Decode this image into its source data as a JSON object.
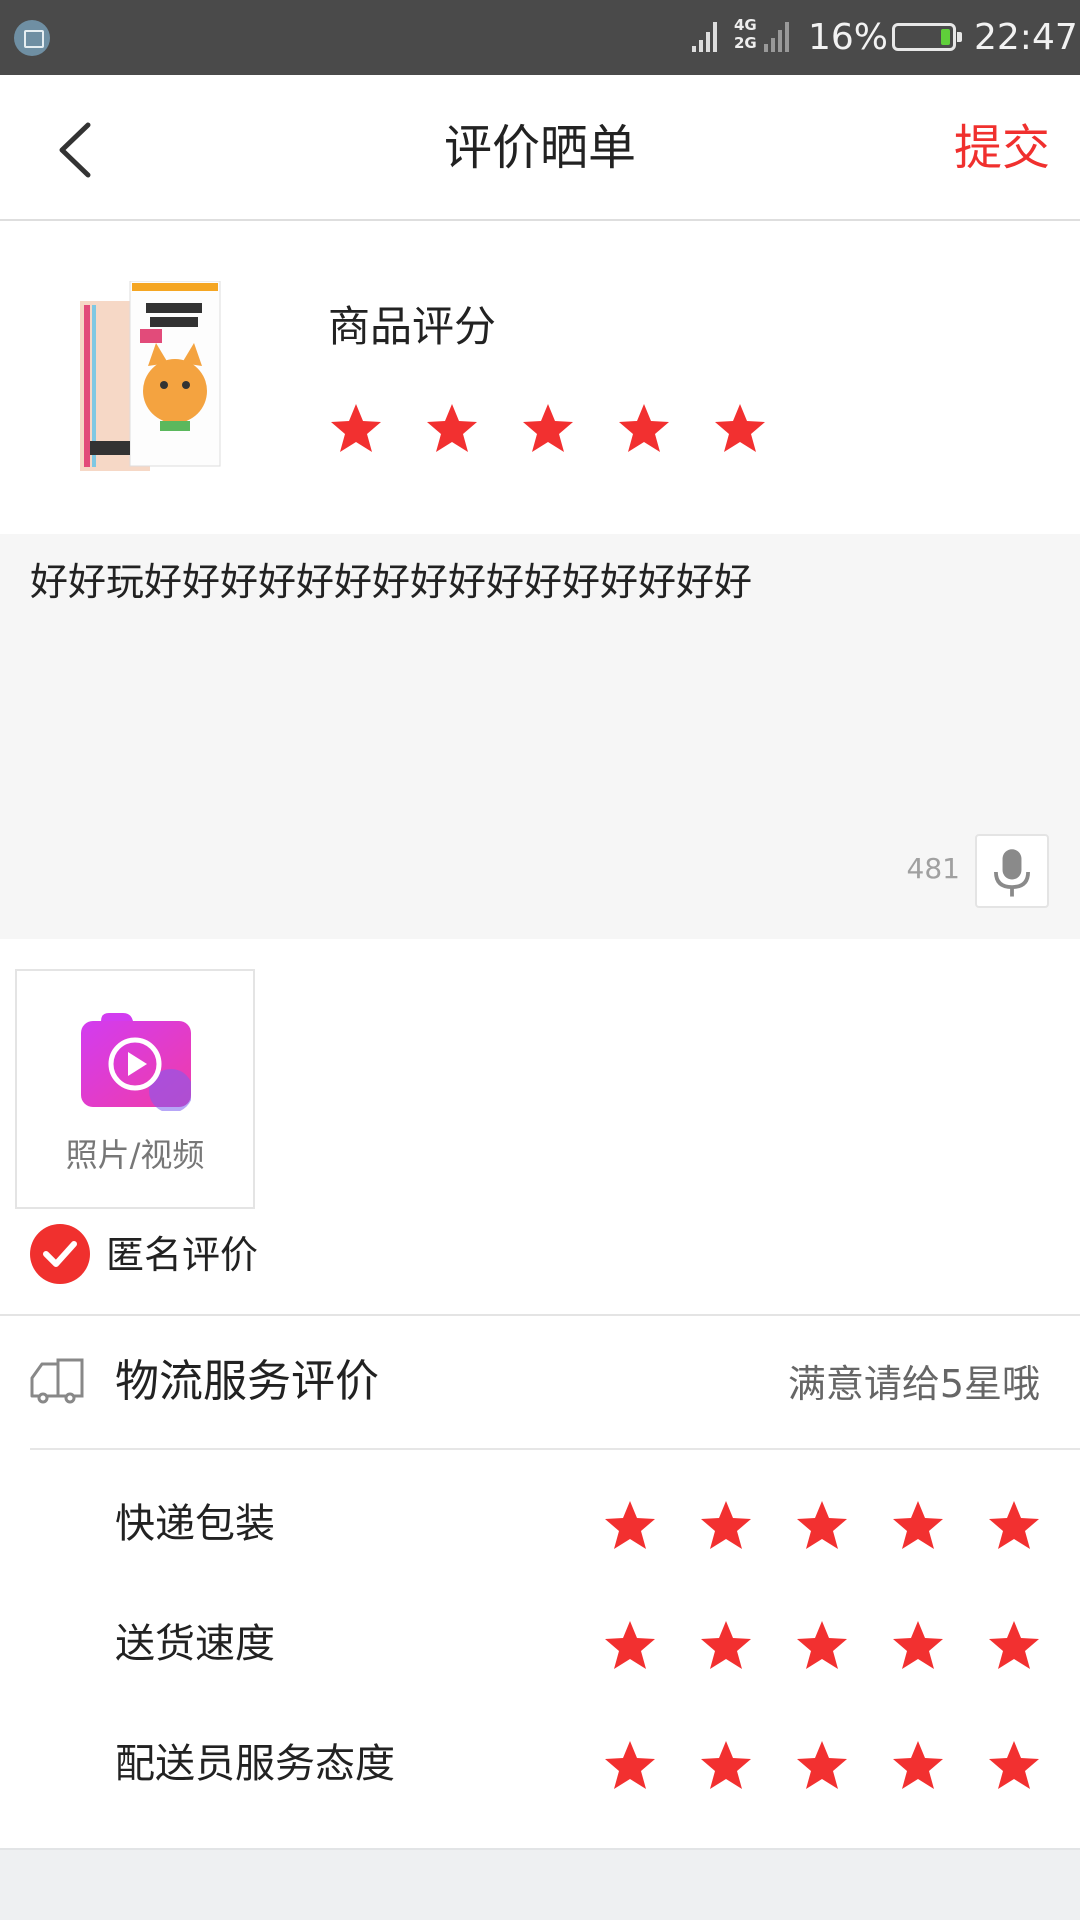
{
  "status_bar": {
    "network": "4G",
    "network2": "2G",
    "battery_percent": "16%",
    "battery_level": 0.16,
    "time": "22:47",
    "app_icon": "screenshot-icon"
  },
  "nav": {
    "title": "评价晒单",
    "submit": "提交",
    "back_icon": "back-arrow-icon"
  },
  "product": {
    "rating_label": "商品评分",
    "rating": 5,
    "max_rating": 5
  },
  "review": {
    "text": "好好玩好好好好好好好好好好好好好好好好",
    "remaining_chars": "481",
    "mic_icon": "microphone-icon"
  },
  "upload": {
    "label": "照片/视频",
    "icon": "camera-video-icon"
  },
  "anonymous": {
    "label": "匿名评价",
    "checked": true
  },
  "logistics": {
    "title": "物流服务评价",
    "hint": "满意请给5星哦",
    "icon": "truck-icon",
    "rows": [
      {
        "label": "快递包装",
        "rating": 5
      },
      {
        "label": "送货速度",
        "rating": 5
      },
      {
        "label": "配送员服务态度",
        "rating": 5
      }
    ]
  },
  "colors": {
    "accent": "#f0302e",
    "star": "#f23030",
    "statusbar": "#4a4a4a",
    "input_bg": "#f6f6f6"
  }
}
